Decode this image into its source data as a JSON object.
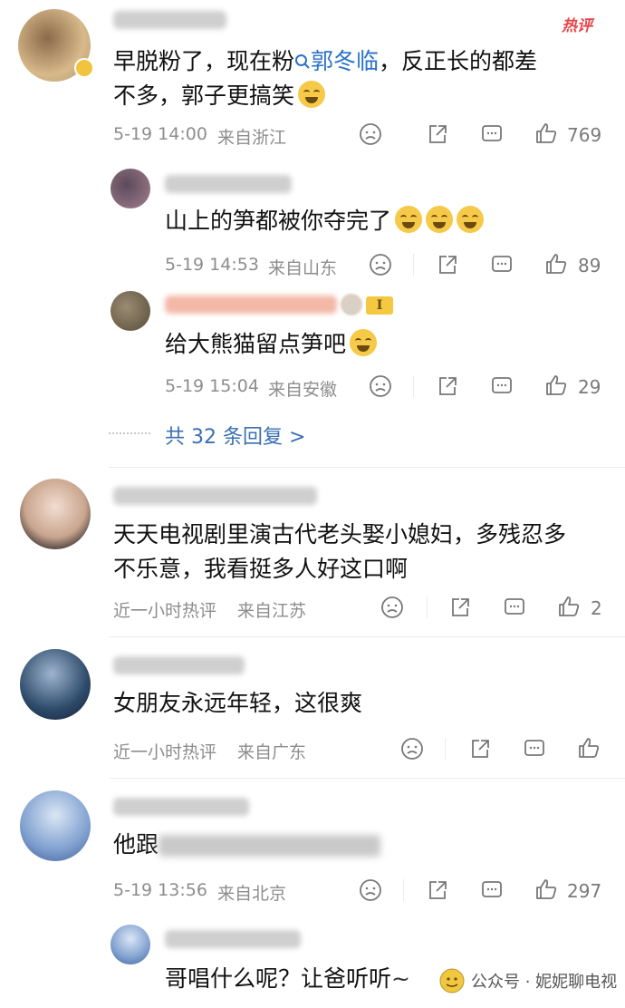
{
  "comments": [
    {
      "text_line1_pre": "早脱粉了，现在粉",
      "mention": "郭冬临",
      "text_line1_post": "，反正长的都差",
      "text_line2": "不多，郭子更搞笑",
      "time": "5-19 14:00",
      "location": "来自浙江",
      "likes": "769",
      "badge": "热评",
      "replies": [
        {
          "text": "山上的笋都被你夺完了",
          "time": "5-19 14:53",
          "location": "来自山东",
          "likes": "89"
        },
        {
          "text": "给大熊猫留点笋吧",
          "time": "5-19 15:04",
          "location": "来自安徽",
          "likes": "29",
          "level": "I"
        }
      ],
      "more_replies": "共 32 条回复 >"
    },
    {
      "text_line1": "天天电视剧里演古代老头娶小媳妇，多残忍多",
      "text_line2": "不乐意，我看挺多人好这口啊",
      "time": "近一小时热评",
      "location": "来自江苏",
      "likes": "2"
    },
    {
      "text_line1": "女朋友永远年轻，这很爽",
      "time": "近一小时热评",
      "location": "来自广东"
    },
    {
      "text_line1": "他跟",
      "time": "5-19 13:56",
      "location": "来自北京",
      "likes": "297",
      "replies": [
        {
          "text": "哥唱什么呢？让爸听听"
        }
      ]
    }
  ],
  "watermark": "公众号 · 妮妮聊电视",
  "colors": {
    "link": "#2a72c7",
    "hot_badge": "#e8454a",
    "meta": "#8d8d8d"
  },
  "icons": [
    "search-icon",
    "dislike-icon",
    "share-icon",
    "comment-icon",
    "like-icon",
    "laughing-emoji",
    "crying-emoji"
  ]
}
